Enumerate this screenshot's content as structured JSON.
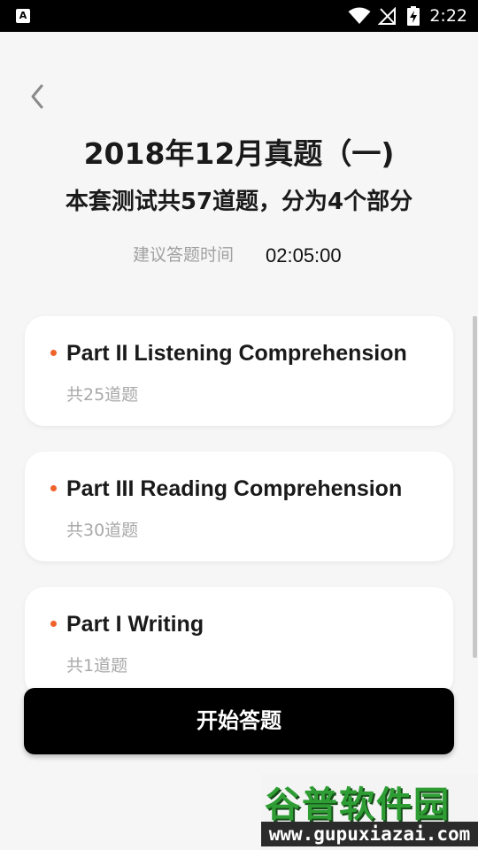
{
  "status_bar": {
    "app_icon_letter": "A",
    "time": "2:22"
  },
  "header": {
    "title": "2018年12月真题（一)",
    "subtitle": "本套测试共57道题，分为4个部分",
    "time_label": "建议答题时间",
    "time_value": "02:05:00"
  },
  "parts": [
    {
      "name": "Part II Listening Comprehension",
      "count": "共25道题"
    },
    {
      "name": "Part III Reading Comprehension",
      "count": "共30道题"
    },
    {
      "name": "Part I Writing",
      "count": "共1道题"
    }
  ],
  "start_button": {
    "label": "开始答题"
  },
  "watermark": {
    "brand": "谷普软件园",
    "url": "www.gupuxiazai.com"
  },
  "colors": {
    "accent_dot": "#f0622b",
    "button_bg": "#000000",
    "page_bg": "#f6f6f6"
  }
}
